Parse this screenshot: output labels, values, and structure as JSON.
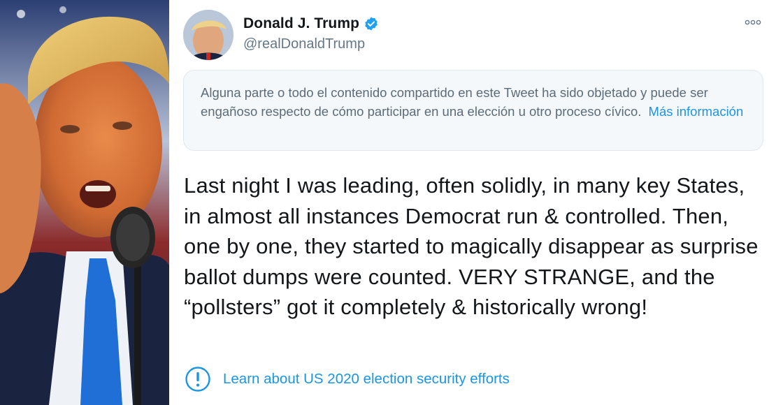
{
  "photo": {
    "subject_icon": "portrait-photo"
  },
  "tweet": {
    "display_name": "Donald J. Trump",
    "handle": "@realDonaldTrump",
    "verified_icon": "verified-badge-icon",
    "more_icon": "more-options-icon",
    "notice": {
      "text": "Alguna parte o todo el contenido compartido en este Tweet ha sido objetado y puede ser engañoso respecto de cómo participar en una elección u otro proceso cívico.",
      "link_label": "Más información"
    },
    "text": "Last night I was leading, often solidly, in many key States, in almost all instances Democrat run & controlled. Then, one by one, they started to magically disappear as surprise ballot dumps were counted. VERY STRANGE, and the “pollsters” got it completely & historically wrong!",
    "learn_more": {
      "icon": "exclamation-circle-icon",
      "label": "Learn about US 2020 election security efforts"
    }
  },
  "colors": {
    "accent": "#1b95e0",
    "secondary_text": "#657786",
    "notice_bg": "#f5f8fa",
    "notice_border": "#e1e8ed"
  }
}
